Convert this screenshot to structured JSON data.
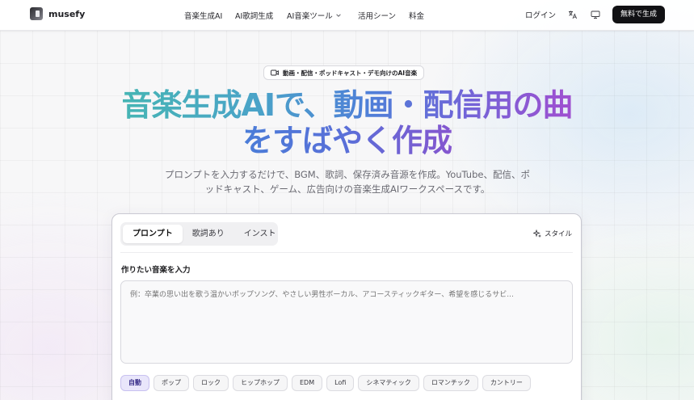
{
  "brand": {
    "name": "musefy"
  },
  "nav": {
    "items": [
      {
        "label": "音楽生成AI"
      },
      {
        "label": "AI歌詞生成"
      },
      {
        "label": "AI音楽ツール"
      },
      {
        "label": "活用シーン"
      },
      {
        "label": "料金"
      }
    ]
  },
  "header": {
    "login": "ログイン",
    "cta": "無料で生成",
    "icons": [
      "translate-icon",
      "monitor-icon"
    ]
  },
  "hero": {
    "badge": "動画・配信・ポッドキャスト・デモ向けのAI音楽",
    "title_line1": "音楽生成AIで、動画・配信用の曲",
    "title_line2": "をすばやく作成",
    "subtitle": "プロンプトを入力するだけで、BGM、歌詞、保存済み音源を作成。YouTube、配信、ポッドキャスト、ゲーム、広告向けの音楽生成AIワークスペースです。"
  },
  "card": {
    "tabs": [
      {
        "label": "プロンプト",
        "active": true
      },
      {
        "label": "歌詞あり",
        "active": false
      },
      {
        "label": "インスト",
        "active": false
      }
    ],
    "style_label": "スタイル",
    "field_label": "作りたい音楽を入力",
    "prompt_placeholder": "例：卒業の思い出を歌う温かいポップソング、やさしい男性ボーカル、アコースティックギター、希望を感じるサビ...",
    "chips": [
      {
        "label": "自動",
        "active": true
      },
      {
        "label": "ポップ"
      },
      {
        "label": "ロック"
      },
      {
        "label": "ヒップホップ"
      },
      {
        "label": "EDM"
      },
      {
        "label": "Lofi"
      },
      {
        "label": "シネマティック"
      },
      {
        "label": "ロマンチック"
      },
      {
        "label": "カントリー"
      }
    ]
  }
}
